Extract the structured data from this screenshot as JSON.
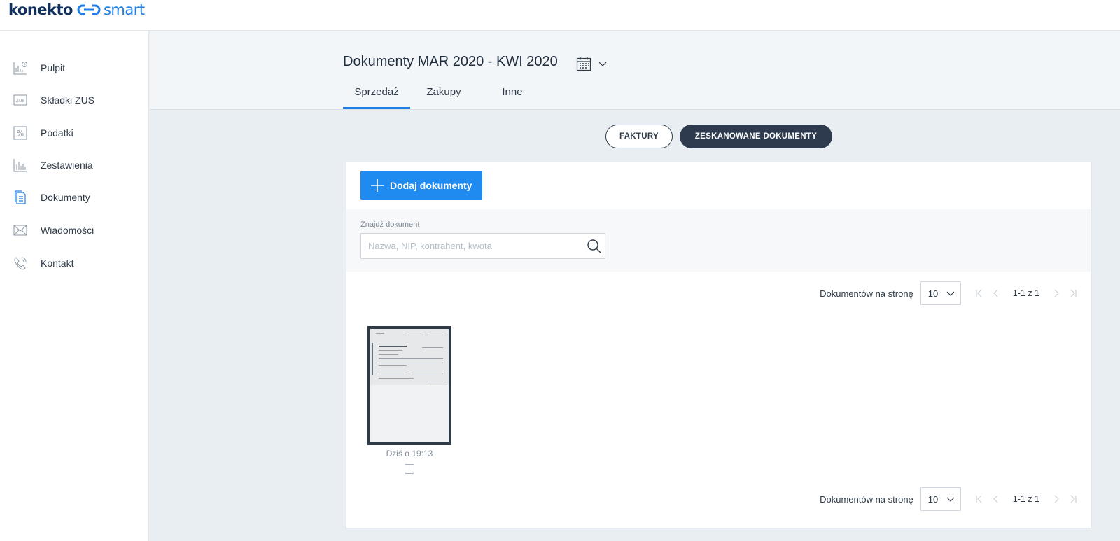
{
  "brand": {
    "part1": "konekto",
    "part2": "smart",
    "accent": "#1f7ee6",
    "dark": "#12315e"
  },
  "sidebar": {
    "items": [
      {
        "label": "Pulpit",
        "icon": "dashboard-icon"
      },
      {
        "label": "Składki ZUS",
        "icon": "zus-icon"
      },
      {
        "label": "Podatki",
        "icon": "percent-icon"
      },
      {
        "label": "Zestawienia",
        "icon": "bar-chart-icon"
      },
      {
        "label": "Dokumenty",
        "icon": "document-icon",
        "active": true
      },
      {
        "label": "Wiadomości",
        "icon": "envelope-icon"
      },
      {
        "label": "Kontakt",
        "icon": "phone-icon"
      }
    ],
    "zus_icon_text": "ZUS",
    "percent_icon_text": "%"
  },
  "header": {
    "title": "Dokumenty MAR 2020 - KWI 2020",
    "tabs": [
      {
        "label": "Sprzedaż",
        "active": true
      },
      {
        "label": "Zakupy"
      },
      {
        "label": "Inne"
      }
    ]
  },
  "toggle": {
    "invoices": "FAKTURY",
    "scanned": "ZESKANOWANE DOKUMENTY",
    "selected": "scanned"
  },
  "card": {
    "add_button": "Dodaj dokumenty",
    "search": {
      "label": "Znajdź dokument",
      "placeholder": "Nazwa, NIP, kontrahent, kwota",
      "value": ""
    },
    "pager": {
      "label": "Dokumentów na stronę",
      "per_page": "10",
      "range": "1-1 z 1"
    },
    "documents": [
      {
        "date": "Dziś o 19:13",
        "checked": false
      }
    ]
  }
}
